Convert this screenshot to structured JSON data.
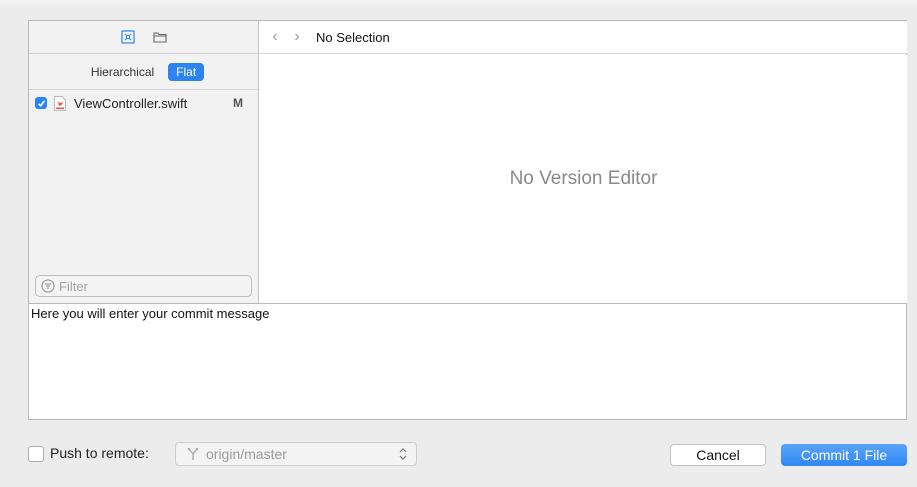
{
  "navigator": {
    "icons": [
      "source-control-icon",
      "folder-icon"
    ],
    "segments": [
      {
        "label": "Hierarchical",
        "active": false
      },
      {
        "label": "Flat",
        "active": true
      }
    ],
    "files": [
      {
        "name": "ViewController.swift",
        "status": "M",
        "checked": true,
        "icon": "swift-file-icon"
      }
    ],
    "filter_placeholder": "Filter"
  },
  "editor": {
    "back_arrow": "‹",
    "forward_arrow": "›",
    "selection_label": "No Selection",
    "empty_message": "No Version Editor"
  },
  "commit": {
    "message": "Here you will enter your commit message"
  },
  "bottom": {
    "push_label": "Push to remote:",
    "push_checked": false,
    "branch": "origin/master",
    "cancel_label": "Cancel",
    "commit_label": "Commit 1 File"
  },
  "colors": {
    "accent": "#2b84f0",
    "window_bg": "#ececec"
  }
}
